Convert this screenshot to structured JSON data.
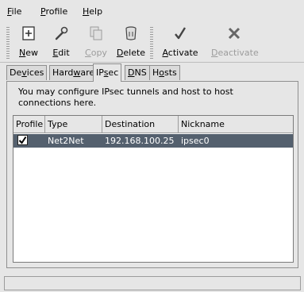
{
  "menubar": {
    "items": [
      {
        "label_pre": "",
        "label_u": "F",
        "label_post": "ile"
      },
      {
        "label_pre": "",
        "label_u": "P",
        "label_post": "rofile"
      },
      {
        "label_pre": "",
        "label_u": "H",
        "label_post": "elp"
      }
    ]
  },
  "toolbar": {
    "new": {
      "pre": "",
      "u": "N",
      "post": "ew",
      "icon": "new-icon"
    },
    "edit": {
      "pre": "",
      "u": "E",
      "post": "dit",
      "icon": "wrench-icon"
    },
    "copy": {
      "pre": "",
      "u": "C",
      "post": "opy",
      "icon": "copy-icon"
    },
    "delete": {
      "pre": "",
      "u": "D",
      "post": "elete",
      "icon": "trash-icon"
    },
    "activate": {
      "pre": "",
      "u": "A",
      "post": "ctivate",
      "icon": "checkmark-icon"
    },
    "deactivate": {
      "pre": "",
      "u": "D",
      "post": "eactivate",
      "icon": "x-icon"
    }
  },
  "tabs": [
    {
      "pre": "De",
      "u": "v",
      "post": "ices"
    },
    {
      "pre": "Hard",
      "u": "w",
      "post": "are"
    },
    {
      "pre": "IP",
      "u": "s",
      "post": "ec"
    },
    {
      "pre": "",
      "u": "D",
      "post": "NS"
    },
    {
      "pre": "H",
      "u": "o",
      "post": "sts"
    }
  ],
  "ipsec": {
    "description": "You may configure IPsec tunnels and host to host connections here.",
    "columns": [
      "Profile",
      "Type",
      "Destination",
      "Nickname"
    ],
    "rows": [
      {
        "profile_checked": true,
        "type": "Net2Net",
        "destination": "192.168.100.25",
        "nickname": "ipsec0"
      }
    ]
  },
  "colors": {
    "selection": "#54606e",
    "background": "#e6e6e6"
  }
}
